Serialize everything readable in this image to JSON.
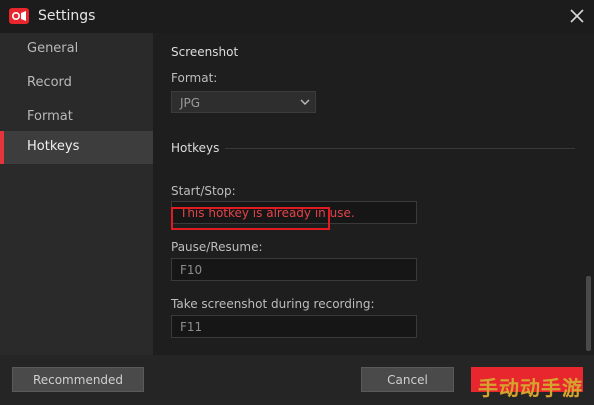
{
  "window": {
    "title": "Settings",
    "app_icon": "record-camera-icon",
    "close_icon": "close-icon"
  },
  "sidebar": {
    "items": [
      {
        "label": "General",
        "active": false
      },
      {
        "label": "Record",
        "active": false
      },
      {
        "label": "Format",
        "active": false
      },
      {
        "label": "Hotkeys",
        "active": true
      }
    ]
  },
  "screenshot": {
    "section_title": "Screenshot",
    "format_label": "Format:",
    "format_value": "JPG"
  },
  "hotkeys": {
    "section_title": "Hotkeys",
    "start_stop_label": "Start/Stop:",
    "start_stop_error": "This hotkey is already in use.",
    "pause_resume_label": "Pause/Resume:",
    "pause_resume_value": "F10",
    "take_screenshot_label": "Take screenshot during recording:",
    "take_screenshot_value": "F11"
  },
  "footer": {
    "recommended_label": "Recommended",
    "cancel_label": "Cancel",
    "ok_label": ""
  },
  "watermark": {
    "text": "手动动手游"
  },
  "colors": {
    "accent": "#e5343b",
    "error": "#e2434a",
    "primary_button": "#e8262e"
  }
}
